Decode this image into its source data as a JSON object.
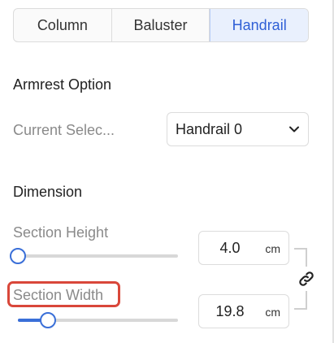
{
  "tabs": [
    {
      "label": "Column",
      "active": false
    },
    {
      "label": "Baluster",
      "active": false
    },
    {
      "label": "Handrail",
      "active": true
    }
  ],
  "armrest": {
    "heading": "Armrest Option",
    "current_label": "Current Selec...",
    "selected_value": "Handrail 0",
    "dropdown_icon": "chevron-down-icon"
  },
  "dimension": {
    "heading": "Dimension",
    "section_height": {
      "label": "Section Height",
      "value": "4.0",
      "unit": "cm",
      "slider_fraction": 0.0
    },
    "section_width": {
      "label": "Section Width",
      "value": "19.8",
      "unit": "cm",
      "slider_fraction": 0.19
    },
    "link_icon": "link-icon"
  },
  "colors": {
    "accent": "#3a6fd8",
    "active_tab_bg": "#e9f0fd",
    "highlight": "#d9473a"
  }
}
